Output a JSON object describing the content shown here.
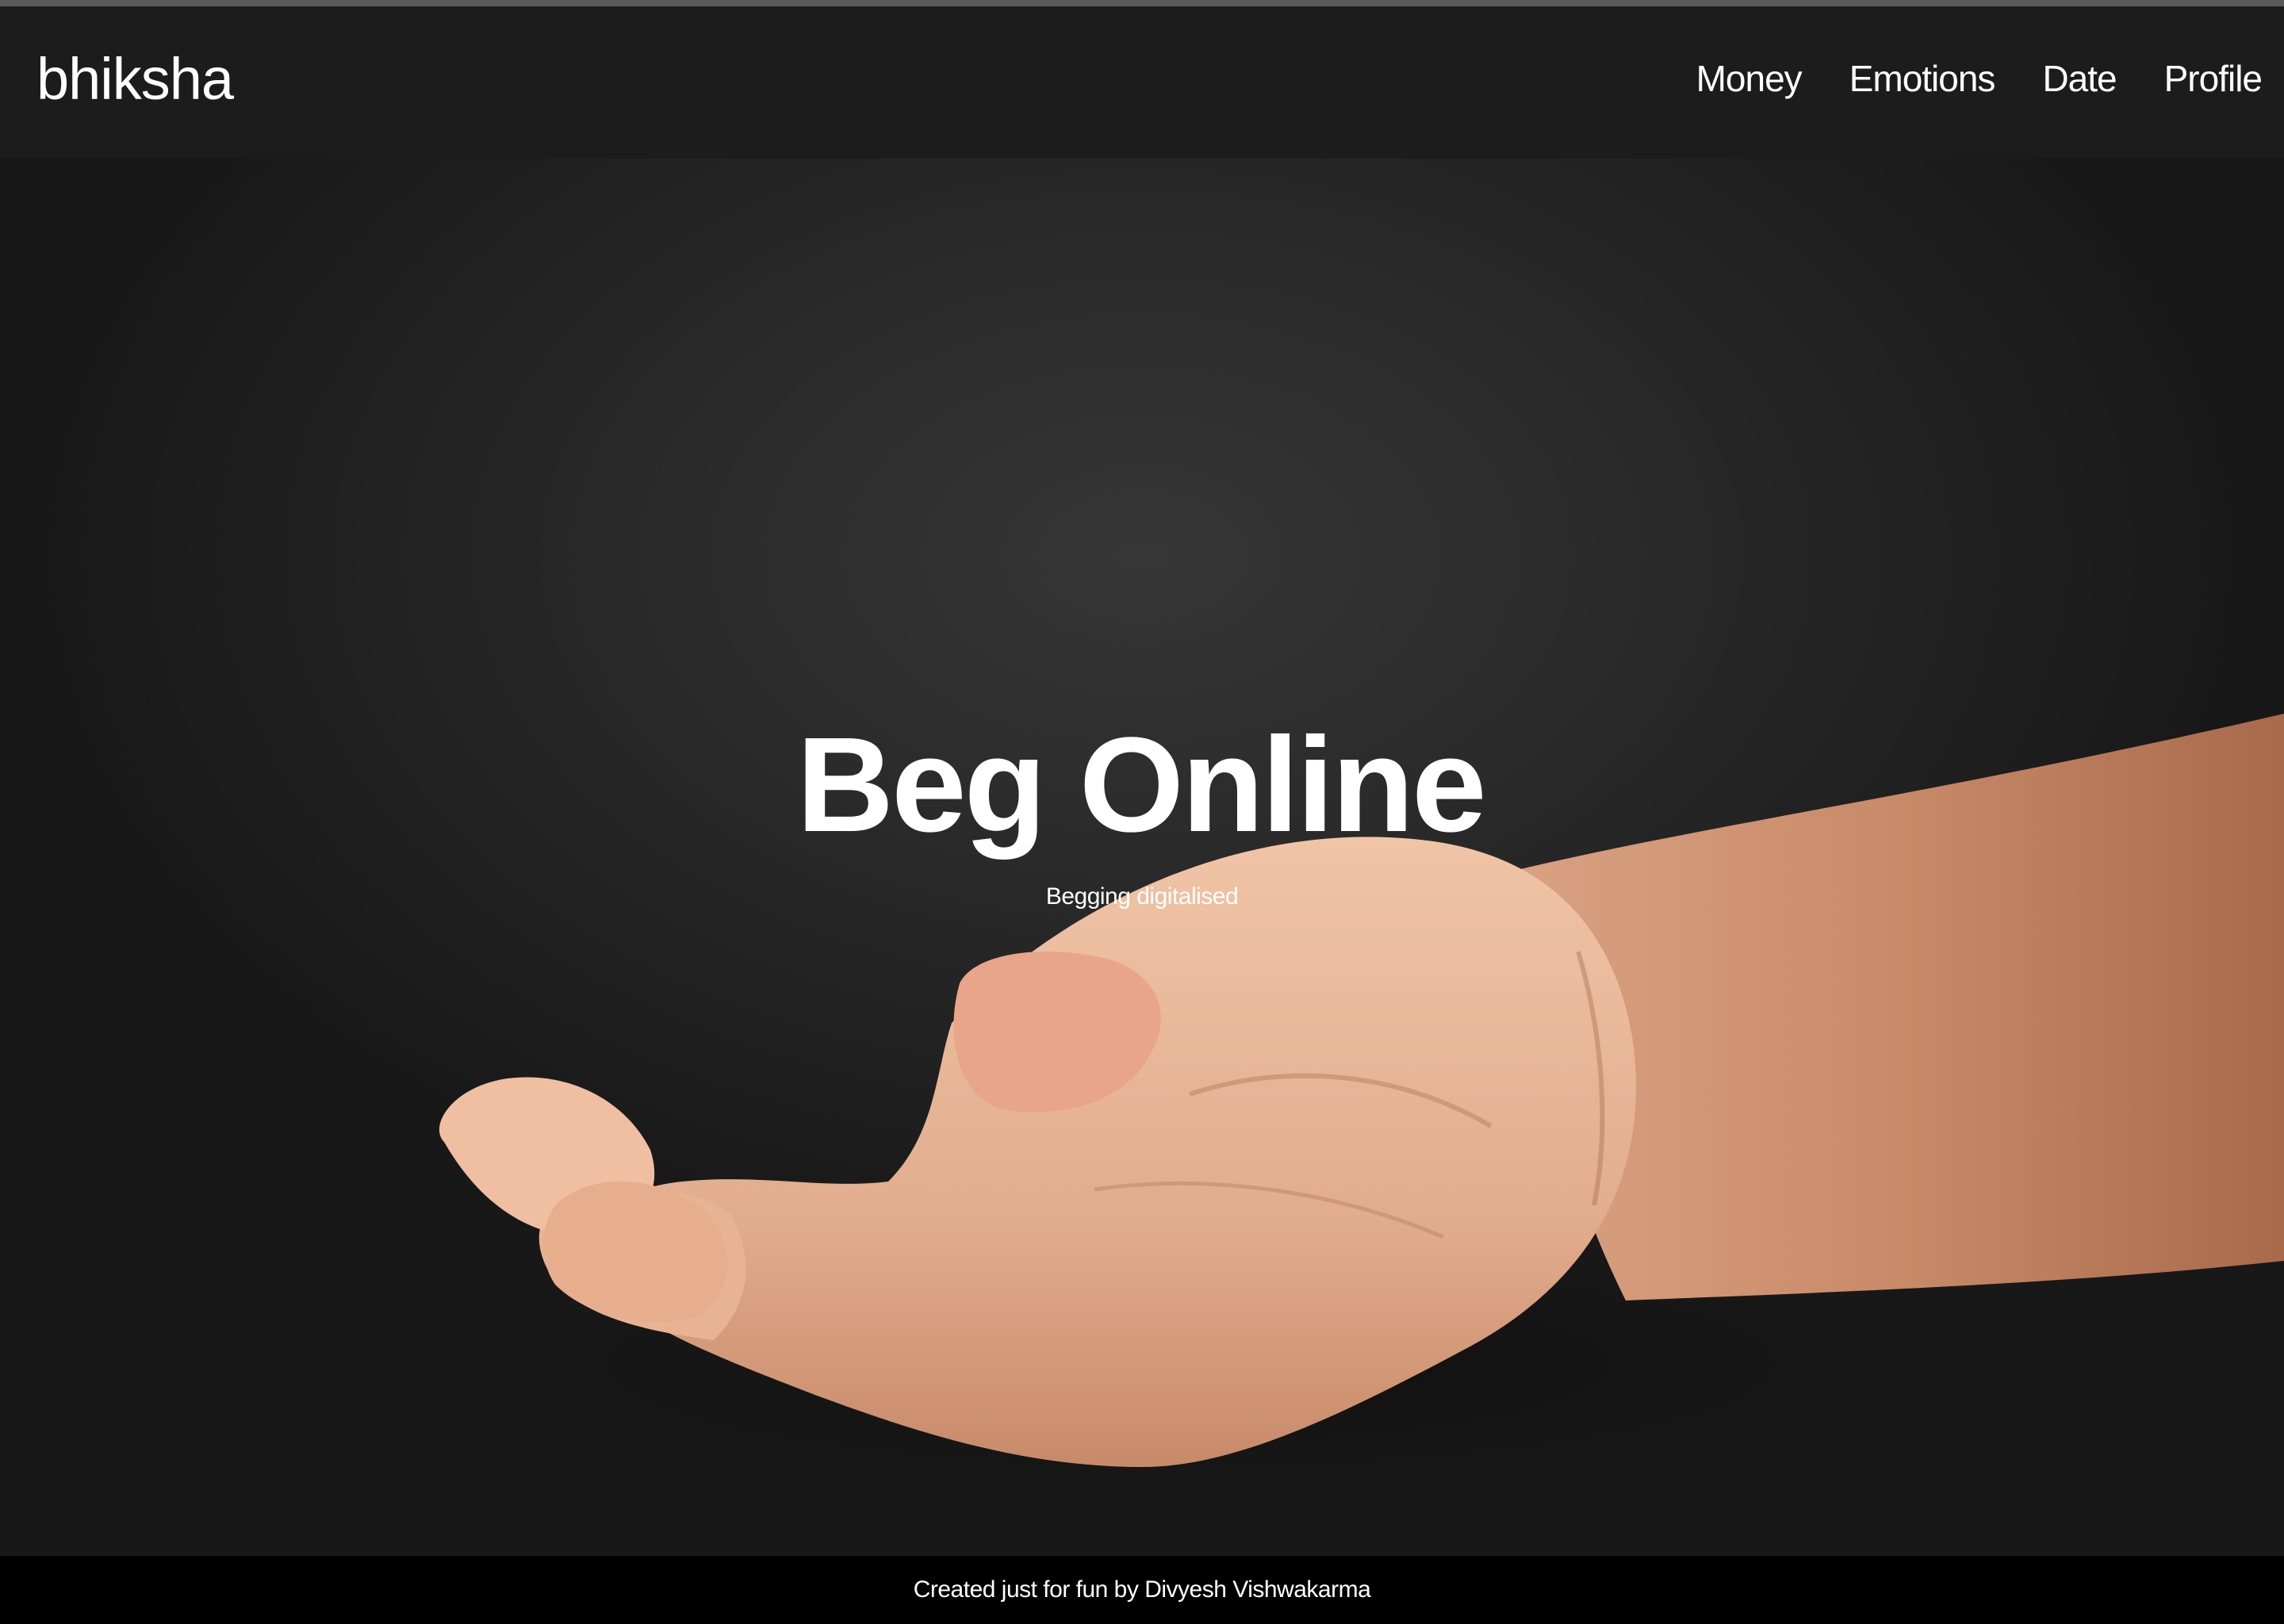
{
  "navbar": {
    "brand": "bhiksha",
    "links": [
      {
        "label": "Money"
      },
      {
        "label": "Emotions"
      },
      {
        "label": "Date"
      },
      {
        "label": "Profile"
      }
    ]
  },
  "hero": {
    "title": "Beg Online",
    "subtitle": "Begging digitalised"
  },
  "footer": {
    "text": "Created just for fun by Divyesh Vishwakarma"
  },
  "colors": {
    "navbar_bg": "#1c1c1c",
    "hero_bg": "#2b2b2b",
    "footer_bg": "#000000",
    "text": "#ffffff"
  }
}
